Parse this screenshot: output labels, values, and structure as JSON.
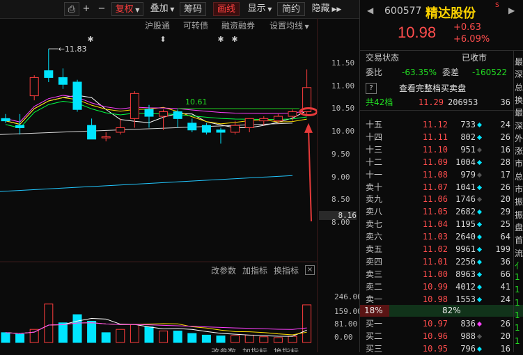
{
  "toolbar": {
    "lock": "⎙",
    "plus": "+",
    "minus": "−",
    "restore": "复权",
    "overlay": "叠加",
    "chips": "筹码",
    "draw": "画线",
    "display": "显示",
    "simple": "简约",
    "hide": "隐藏"
  },
  "indicators": {
    "hgt": "沪股通",
    "convertible": "可转债",
    "margin": "融资融券",
    "set_ma": "设置均线"
  },
  "chart": {
    "high_label": "11.83",
    "ma_label": "10.61",
    "y_ticks": [
      "11.50",
      "11.00",
      "10.50",
      "10.00",
      "9.50",
      "9.00",
      "8.50",
      "8.16",
      "8.00"
    ],
    "candles": [
      {
        "o": 10.3,
        "c": 10.25,
        "h": 10.4,
        "l": 10.2
      },
      {
        "o": 10.15,
        "c": 10.1,
        "h": 10.4,
        "l": 9.95
      },
      {
        "o": 10.8,
        "c": 11.2,
        "h": 11.25,
        "l": 10.7
      },
      {
        "o": 11.35,
        "c": 11.2,
        "h": 11.83,
        "l": 11.1
      },
      {
        "o": 11.2,
        "c": 11.05,
        "h": 11.4,
        "l": 10.95
      },
      {
        "o": 11.1,
        "c": 10.5,
        "h": 11.15,
        "l": 10.45
      },
      {
        "o": 10.15,
        "c": 9.85,
        "h": 10.3,
        "l": 9.85
      },
      {
        "o": 9.9,
        "c": 9.9,
        "h": 10.0,
        "l": 9.8
      },
      {
        "o": 10.0,
        "c": 10.1,
        "h": 10.3,
        "l": 9.95
      },
      {
        "o": 10.3,
        "c": 10.85,
        "h": 10.9,
        "l": 10.1
      },
      {
        "o": 10.5,
        "c": 10.35,
        "h": 10.6,
        "l": 10.1
      },
      {
        "o": 10.35,
        "c": 10.45,
        "h": 10.5,
        "l": 10.05
      },
      {
        "o": 10.45,
        "c": 10.3,
        "h": 10.5,
        "l": 10.1
      },
      {
        "o": 10.2,
        "c": 10.05,
        "h": 10.3,
        "l": 10.0
      },
      {
        "o": 10.15,
        "c": 10.0,
        "h": 10.2,
        "l": 9.95
      },
      {
        "o": 10.05,
        "c": 10.0,
        "h": 10.1,
        "l": 9.75
      },
      {
        "o": 10.0,
        "c": 10.15,
        "h": 10.25,
        "l": 9.95
      },
      {
        "o": 10.1,
        "c": 10.3,
        "h": 10.3,
        "l": 10.0
      },
      {
        "o": 10.25,
        "c": 10.3,
        "h": 10.35,
        "l": 10.15
      },
      {
        "o": 10.25,
        "c": 10.35,
        "h": 10.4,
        "l": 10.2
      },
      {
        "o": 10.35,
        "c": 10.45,
        "h": 10.5,
        "l": 10.25
      },
      {
        "o": 10.45,
        "c": 10.98,
        "h": 11.38,
        "l": 10.4
      }
    ],
    "vol_label_params": "改参数",
    "vol_label_add": "加指标",
    "vol_label_switch": "换指标",
    "vol_ticks": [
      "246.00",
      "159.00",
      "81.00",
      "0.00"
    ],
    "volumes": [
      60,
      50,
      80,
      235,
      120,
      170,
      130,
      60,
      80,
      110,
      95,
      70,
      70,
      55,
      45,
      40,
      42,
      45,
      35,
      30,
      38,
      230
    ],
    "volume_up": [
      false,
      false,
      true,
      true,
      false,
      false,
      false,
      false,
      true,
      true,
      false,
      true,
      false,
      false,
      false,
      false,
      true,
      true,
      true,
      true,
      true,
      true
    ]
  },
  "colors": {
    "up": "#ff3d3d",
    "down": "#00e5ff",
    "ma5": "#ffffff",
    "ma10": "#ffe000",
    "ma20": "#ff40ff",
    "ma60": "#00ff44"
  },
  "quote": {
    "code": "600577",
    "name": "精达股份",
    "price": "10.98",
    "change": "+0.63",
    "change_pct": "+6.09%",
    "status_label": "交易状态",
    "status_value": "已收市",
    "wb_label": "委比",
    "wb_value": "-63.35%",
    "wc_label": "委差",
    "wc_value": "-160522",
    "full_book": "查看完整档买卖盘",
    "total_label": "共42档",
    "total_price": "11.29",
    "total_vol": "206953",
    "total_cnt": "36",
    "asks": [
      {
        "label": "十五",
        "price": "11.12",
        "vol": "733",
        "cnt": "24",
        "c": "#00e5ff"
      },
      {
        "label": "十四",
        "price": "11.11",
        "vol": "802",
        "cnt": "26",
        "c": "#00e5ff"
      },
      {
        "label": "十三",
        "price": "11.10",
        "vol": "951",
        "cnt": "16",
        "c": "#555555"
      },
      {
        "label": "十二",
        "price": "11.09",
        "vol": "1004",
        "cnt": "28",
        "c": "#00e5ff"
      },
      {
        "label": "十一",
        "price": "11.08",
        "vol": "979",
        "cnt": "17",
        "c": "#555555"
      },
      {
        "label": "卖十",
        "price": "11.07",
        "vol": "1041",
        "cnt": "26",
        "c": "#00e5ff"
      },
      {
        "label": "卖九",
        "price": "11.06",
        "vol": "1746",
        "cnt": "20",
        "c": "#555555"
      },
      {
        "label": "卖八",
        "price": "11.05",
        "vol": "2682",
        "cnt": "29",
        "c": "#00e5ff"
      },
      {
        "label": "卖七",
        "price": "11.04",
        "vol": "1195",
        "cnt": "25",
        "c": "#00e5ff"
      },
      {
        "label": "卖六",
        "price": "11.03",
        "vol": "2640",
        "cnt": "64",
        "c": "#00e5ff"
      },
      {
        "label": "卖五",
        "price": "11.02",
        "vol": "9961",
        "cnt": "199",
        "c": "#00e5ff"
      },
      {
        "label": "卖四",
        "price": "11.01",
        "vol": "2256",
        "cnt": "36",
        "c": "#00e5ff"
      },
      {
        "label": "卖三",
        "price": "11.00",
        "vol": "8963",
        "cnt": "66",
        "c": "#00e5ff"
      },
      {
        "label": "卖二",
        "price": "10.99",
        "vol": "4012",
        "cnt": "41",
        "c": "#00e5ff"
      },
      {
        "label": "卖一",
        "price": "10.98",
        "vol": "1553",
        "cnt": "24",
        "c": "#00e5ff"
      }
    ],
    "ratio_left": "18%",
    "ratio_right": "82%",
    "bids": [
      {
        "label": "买一",
        "price": "10.97",
        "vol": "836",
        "cnt": "26",
        "c": "#ff40ff"
      },
      {
        "label": "买二",
        "price": "10.96",
        "vol": "988",
        "cnt": "20",
        "c": "#555555"
      },
      {
        "label": "买三",
        "price": "10.95",
        "vol": "796",
        "cnt": "16",
        "c": "#00e5ff"
      }
    ],
    "edge_chars": [
      "最",
      "深",
      "总",
      "换",
      "最",
      "深",
      "外",
      "涨",
      "市",
      "总",
      "市",
      "振",
      "振",
      "盘",
      "首",
      "流",
      "亻",
      "1",
      "1",
      "1",
      "1",
      "1",
      "1"
    ]
  }
}
